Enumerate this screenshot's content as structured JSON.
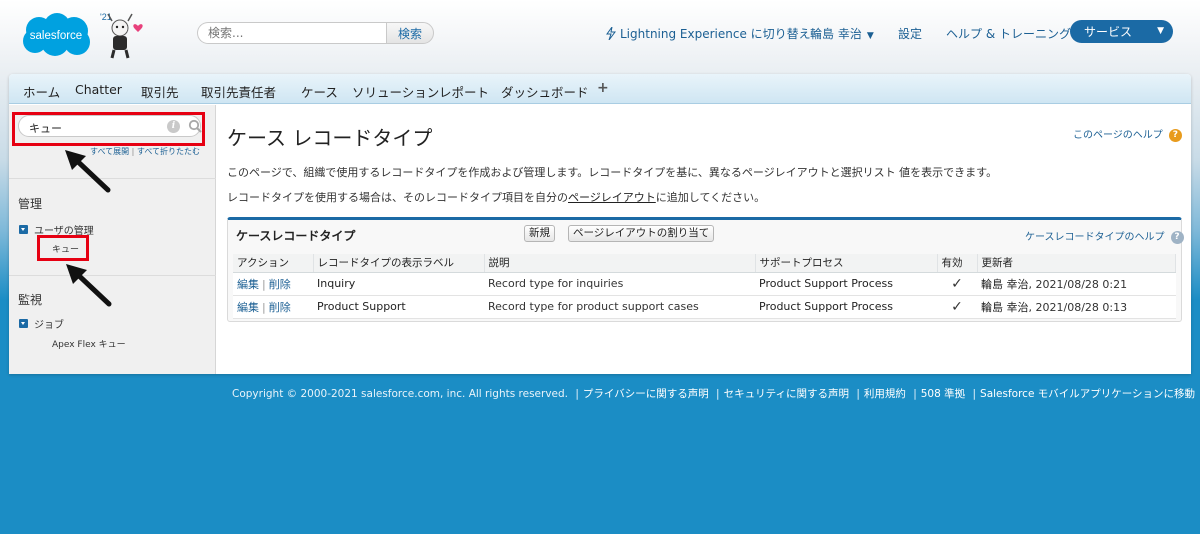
{
  "header": {
    "logo_text": "salesforce",
    "release_badge": "'21",
    "search_placeholder": "検索...",
    "search_button": "検索",
    "lightning_link": "Lightning Experience に切り替え",
    "user_name": "輪島 幸治",
    "setup_link": "設定",
    "help_link": "ヘルプ & トレーニング",
    "app_menu": "サービス"
  },
  "tabs": [
    "ホーム",
    "Chatter",
    "取引先",
    "取引先責任者",
    "ケース",
    "ソリューション",
    "レポート",
    "ダッシュボード",
    "+"
  ],
  "sidebar": {
    "search_value": "キュー",
    "expand_all": "すべて展開",
    "collapse_all": "すべて折りたたむ",
    "section_admin": "管理",
    "user_mgmt": "ユーザの管理",
    "queue_item": "キュー",
    "section_monitor": "監視",
    "jobs": "ジョブ",
    "apex_flex": "Apex Flex キュー"
  },
  "content": {
    "title": "ケース レコードタイプ",
    "page_help": "このページのヘルプ",
    "desc1": "このページで、組織で使用するレコードタイプを作成および管理します。レコードタイプを基に、異なるページレイアウトと選択リスト 値を表示できます。",
    "desc2_pre": "レコードタイプを使用する場合は、そのレコードタイプ項目を自分の",
    "desc2_link": "ページレイアウト",
    "desc2_post": "に追加してください。",
    "section_title": "ケースレコードタイプ",
    "new_button": "新規",
    "assign_button": "ページレイアウトの割り当て",
    "section_help": "ケースレコードタイプのヘルプ",
    "columns": [
      "アクション",
      "レコードタイプの表示ラベル",
      "説明",
      "サポートプロセス",
      "有効",
      "更新者"
    ],
    "rows": [
      {
        "edit": "編集",
        "del": "削除",
        "label": "Inquiry",
        "description": "Record type for inquiries",
        "process": "Product Support Process",
        "active": "✓",
        "modified_by": "輪島 幸治",
        "modified_at": ", 2021/08/28 0:21"
      },
      {
        "edit": "編集",
        "del": "削除",
        "label": "Product Support",
        "description": "Record type for product support cases",
        "process": "Product Support Process",
        "active": "✓",
        "modified_by": "輪島 幸治",
        "modified_at": ", 2021/08/28 0:13"
      }
    ]
  },
  "footer": {
    "copyright": "Copyright © 2000-2021 salesforce.com, inc. All rights reserved.",
    "links": [
      "プライバシーに関する声明",
      "セキュリティに関する声明",
      "利用規約",
      "508 準拠",
      "Salesforce モバイルアプリケーションに移動"
    ]
  },
  "colors": {
    "brand_blue": "#1b6aa5",
    "annotation_red": "#e60012",
    "background_blue": "#1b8dc5"
  }
}
